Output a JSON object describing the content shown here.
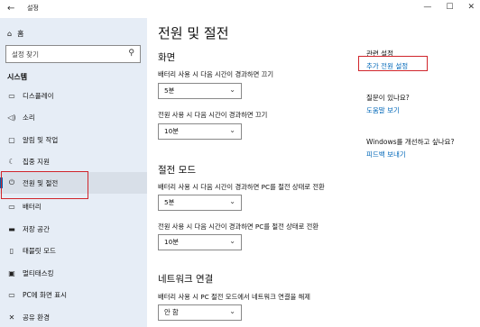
{
  "window": {
    "title": "설정",
    "minimize": "—",
    "maximize": "☐",
    "close": "✕"
  },
  "sidebar": {
    "home_label": "홈",
    "search_placeholder": "설정 찾기",
    "section": "시스템",
    "items": [
      {
        "label": "디스플레이",
        "icon": "monitor-icon"
      },
      {
        "label": "소리",
        "icon": "speaker-icon"
      },
      {
        "label": "알림 및 작업",
        "icon": "notification-icon"
      },
      {
        "label": "집중 지원",
        "icon": "moon-icon"
      },
      {
        "label": "전원 및 절전",
        "icon": "power-icon",
        "active": true
      },
      {
        "label": "배터리",
        "icon": "battery-icon"
      },
      {
        "label": "저장 공간",
        "icon": "storage-icon"
      },
      {
        "label": "태블릿 모드",
        "icon": "tablet-icon"
      },
      {
        "label": "멀티태스킹",
        "icon": "multitask-icon"
      },
      {
        "label": "PC에 화면 표시",
        "icon": "project-icon"
      },
      {
        "label": "공유 환경",
        "icon": "share-icon"
      }
    ]
  },
  "main": {
    "title": "전원 및 절전",
    "screen": {
      "heading": "화면",
      "battery_label": "배터리 사용 시 다음 시간이 경과하면 끄기",
      "battery_value": "5분",
      "plugged_label": "전원 사용 시 다음 시간이 경과하면 끄기",
      "plugged_value": "10분"
    },
    "sleep": {
      "heading": "절전 모드",
      "battery_label": "배터리 사용 시 다음 시간이 경과하면 PC를 절전 상태로 전환",
      "battery_value": "5분",
      "plugged_label": "전원 사용 시 다음 시간이 경과하면 PC를 절전 상태로 전환",
      "plugged_value": "10분"
    },
    "network": {
      "heading": "네트워크 연결",
      "label": "배터리 사용 시 PC 절전 모드에서 네트워크 연결을 해제",
      "value": "안 함"
    }
  },
  "related": {
    "heading": "관련 설정",
    "link": "추가 전원 설정",
    "question": "질문이 있나요?",
    "help_link": "도움말 보기",
    "improve": "Windows를 개선하고 싶나요?",
    "feedback_link": "피드백 보내기"
  },
  "colors": {
    "sidebar_bg": "#e6edf6",
    "accent": "#0063b1",
    "link": "#0067b8",
    "highlight": "#d0252b"
  }
}
